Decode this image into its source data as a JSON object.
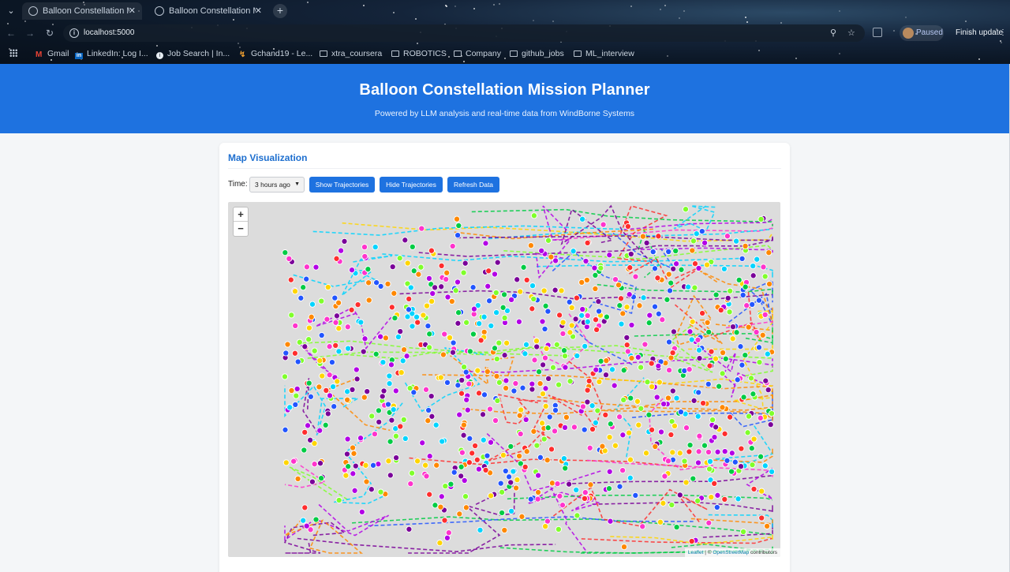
{
  "browser": {
    "tabs": [
      {
        "title": "Balloon Constellation M",
        "state": "inactive"
      },
      {
        "title": "Balloon Constellation M",
        "state": "active"
      }
    ],
    "url": "localhost:5000",
    "profile_status": "Paused",
    "update_label": "Finish update",
    "bookmarks": [
      {
        "label": "Gmail",
        "icon": "gmail-icon"
      },
      {
        "label": "LinkedIn: Log I...",
        "icon": "linkedin-icon"
      },
      {
        "label": "Job Search | In...",
        "icon": "info-icon"
      },
      {
        "label": "Gchand19 - Le...",
        "icon": "leetcode-icon"
      },
      {
        "label": "xtra_coursera",
        "icon": "folder-icon"
      },
      {
        "label": "ROBOTICS",
        "icon": "folder-icon"
      },
      {
        "label": "Company",
        "icon": "folder-icon"
      },
      {
        "label": "github_jobs",
        "icon": "folder-icon"
      },
      {
        "label": "ML_interview",
        "icon": "folder-icon"
      }
    ]
  },
  "header": {
    "title": "Balloon Constellation Mission Planner",
    "subtitle": "Powered by LLM analysis and real-time data from WindBorne Systems",
    "background": "#1e72e0"
  },
  "map_section": {
    "title": "Map Visualization",
    "time_label": "Time:",
    "time_selected": "3 hours ago",
    "buttons": {
      "show": "Show Trajectories",
      "hide": "Hide Trajectories",
      "refresh": "Refresh Data"
    },
    "zoom_in": "+",
    "zoom_out": "−",
    "attribution": {
      "leaflet": "Leaflet",
      "separator": " | © ",
      "osm": "OpenStreetMap",
      "suffix": " contributors"
    },
    "marker_colors": [
      "#ff2d2d",
      "#00cc44",
      "#7fff2a",
      "#2255ff",
      "#b300e6",
      "#ff8800",
      "#00d4ff",
      "#ffd500",
      "#ff33cc",
      "#7a0099"
    ]
  }
}
